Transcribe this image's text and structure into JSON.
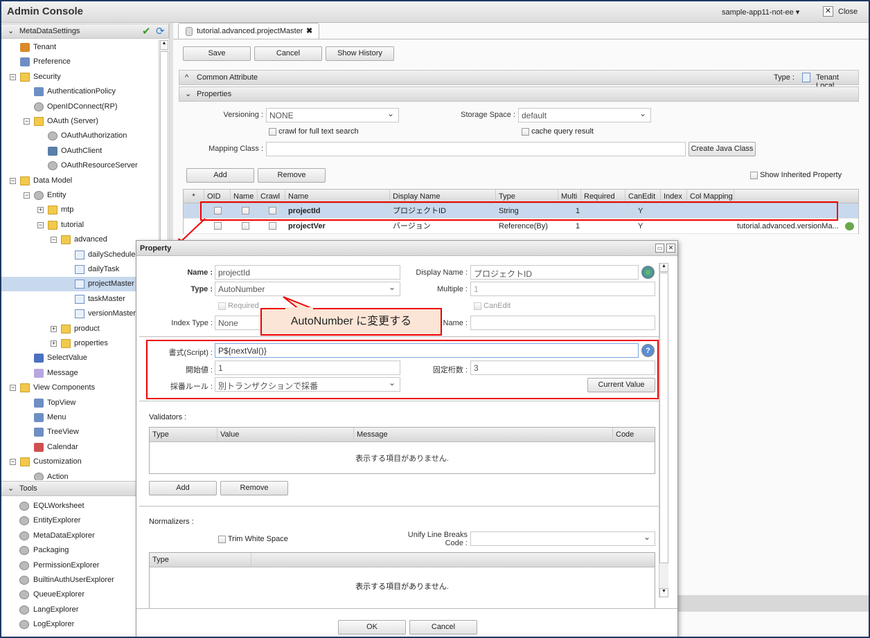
{
  "app": {
    "title": "Admin Console",
    "app_select": "sample-app11-not-ee",
    "close_label": "Close"
  },
  "sidebar": {
    "header": "MetaDataSettings",
    "items": [
      {
        "label": "Tenant",
        "level": 0,
        "toggle": "",
        "icon": "home"
      },
      {
        "label": "Preference",
        "level": 0,
        "toggle": "",
        "icon": "list"
      },
      {
        "label": "Security",
        "level": 0,
        "toggle": "-",
        "icon": "folder"
      },
      {
        "label": "AuthenticationPolicy",
        "level": 1,
        "toggle": "",
        "icon": "card"
      },
      {
        "label": "OpenIDConnect(RP)",
        "level": 1,
        "toggle": "",
        "icon": "gear"
      },
      {
        "label": "OAuth (Server)",
        "level": 1,
        "toggle": "-",
        "icon": "folder"
      },
      {
        "label": "OAuthAuthorization",
        "level": 2,
        "toggle": "",
        "icon": "gear"
      },
      {
        "label": "OAuthClient",
        "level": 2,
        "toggle": "",
        "icon": "monitor"
      },
      {
        "label": "OAuthResourceServer",
        "level": 2,
        "toggle": "",
        "icon": "gear"
      },
      {
        "label": "Data Model",
        "level": 0,
        "toggle": "-",
        "icon": "folder"
      },
      {
        "label": "Entity",
        "level": 1,
        "toggle": "-",
        "icon": "db"
      },
      {
        "label": "mtp",
        "level": 2,
        "toggle": "+",
        "icon": "folder"
      },
      {
        "label": "tutorial",
        "level": 2,
        "toggle": "-",
        "icon": "folder"
      },
      {
        "label": "advanced",
        "level": 3,
        "toggle": "-",
        "icon": "folder"
      },
      {
        "label": "dailySchedule",
        "level": 4,
        "toggle": "",
        "icon": "doc"
      },
      {
        "label": "dailyTask",
        "level": 4,
        "toggle": "",
        "icon": "doc"
      },
      {
        "label": "projectMaster",
        "level": 4,
        "toggle": "",
        "icon": "doc",
        "selected": true
      },
      {
        "label": "taskMaster",
        "level": 4,
        "toggle": "",
        "icon": "doc"
      },
      {
        "label": "versionMaster",
        "level": 4,
        "toggle": "",
        "icon": "doc"
      },
      {
        "label": "product",
        "level": 3,
        "toggle": "+",
        "icon": "folder"
      },
      {
        "label": "properties",
        "level": 3,
        "toggle": "+",
        "icon": "folder"
      },
      {
        "label": "SelectValue",
        "level": 1,
        "toggle": "",
        "icon": "check"
      },
      {
        "label": "Message",
        "level": 1,
        "toggle": "",
        "icon": "bubble"
      },
      {
        "label": "View Components",
        "level": 0,
        "toggle": "-",
        "icon": "folder"
      },
      {
        "label": "TopView",
        "level": 1,
        "toggle": "",
        "icon": "list"
      },
      {
        "label": "Menu",
        "level": 1,
        "toggle": "",
        "icon": "list"
      },
      {
        "label": "TreeView",
        "level": 1,
        "toggle": "",
        "icon": "list"
      },
      {
        "label": "Calendar",
        "level": 1,
        "toggle": "",
        "icon": "calendar"
      },
      {
        "label": "Customization",
        "level": 0,
        "toggle": "-",
        "icon": "folder"
      },
      {
        "label": "Action",
        "level": 1,
        "toggle": "",
        "icon": "gear"
      }
    ],
    "tools_header": "Tools",
    "tools": [
      "EQLWorksheet",
      "EntityExplorer",
      "MetaDataExplorer",
      "Packaging",
      "PermissionExplorer",
      "BuiltinAuthUserExplorer",
      "QueueExplorer",
      "LangExplorer",
      "LogExplorer"
    ]
  },
  "tab": {
    "label": "tutorial.advanced.projectMaster"
  },
  "toolbar": {
    "save": "Save",
    "cancel": "Cancel",
    "history": "Show History"
  },
  "common": {
    "title": "Common Attribute",
    "type_label": "Type :",
    "type_value": "Tenant Local"
  },
  "properties": {
    "title": "Properties",
    "versioning_label": "Versioning :",
    "versioning": "NONE",
    "storage_label": "Storage Space :",
    "storage": "default",
    "crawl": "crawl for full text search",
    "cache": "cache query result",
    "mapping_label": "Mapping Class :",
    "create_java": "Create Java Class",
    "add": "Add",
    "remove": "Remove",
    "show_inherited": "Show Inherited Property",
    "columns": [
      "*",
      "OID",
      "Name",
      "Crawl",
      "Name",
      "Display Name",
      "Type",
      "Multi",
      "Required",
      "CanEdit",
      "Index",
      "Col Mapping"
    ],
    "rows": [
      {
        "name": "projectId",
        "display": "プロジェクトID",
        "type": "String",
        "multi": "1",
        "canedit": "Y",
        "mapping": ""
      },
      {
        "name": "projectVer",
        "display": "バージョン",
        "type": "Reference(By)",
        "multi": "1",
        "canedit": "Y",
        "mapping": "tutorial.advanced.versionMa..."
      }
    ]
  },
  "dialog": {
    "title": "Property",
    "name_label": "Name :",
    "name": "projectId",
    "display_label": "Display Name :",
    "display": "プロジェクトID",
    "type_label": "Type :",
    "type": "AutoNumber",
    "multiple_label": "Multiple :",
    "multiple": "1",
    "required": "Required",
    "canedit": "CanEdit",
    "index_label": "Index Type :",
    "index": "None",
    "colname_label": "Name :",
    "script_label": "書式(Script) :",
    "script": "P${nextVal()}",
    "start_label": "開始値 :",
    "start": "1",
    "digits_label": "固定桁数 :",
    "digits": "3",
    "rule_label": "採番ルール :",
    "rule": "別トランザクションで採番",
    "current_value": "Current Value",
    "validators": "Validators :",
    "val_cols": [
      "Type",
      "Value",
      "Message",
      "Code"
    ],
    "empty": "表示する項目がありません.",
    "add": "Add",
    "remove": "Remove",
    "normalizers": "Normalizers :",
    "trim": "Trim White Space",
    "unify_label": "Unify Line Breaks Code :",
    "norm_cols": [
      "Type"
    ],
    "ok": "OK",
    "cancel": "Cancel"
  },
  "callout": {
    "text": "AutoNumber に変更する"
  },
  "colors": {
    "highlight": "#e00000",
    "callout_bg": "#fbe5d6",
    "selected_row": "#c8d9ee"
  }
}
